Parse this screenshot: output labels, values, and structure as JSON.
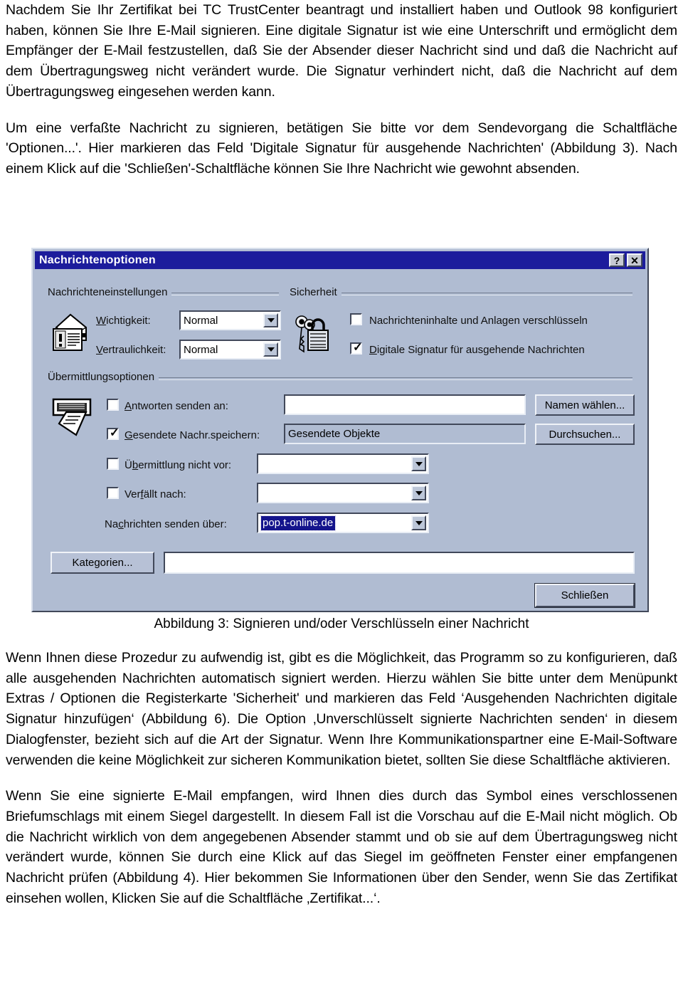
{
  "document": {
    "paragraphs": [
      "Nachdem Sie Ihr Zertifikat bei TC TrustCenter beantragt und installiert haben und Outlook 98 konfiguriert haben, können Sie Ihre E-Mail signieren. Eine digitale Signatur ist wie eine Unterschrift und ermöglicht dem Empfänger der E-Mail festzustellen, daß Sie der Absender dieser Nachricht sind und daß die Nachricht auf dem Übertragungsweg nicht verändert wurde. Die Signatur verhindert nicht, daß die Nachricht auf dem Übertragungsweg eingesehen werden kann.",
      "Um eine verfaßte Nachricht zu signieren, betätigen Sie bitte vor dem Sendevorgang die Schaltfläche 'Optionen...'. Hier markieren das Feld 'Digitale Signatur für ausgehende Nachrichten' (Abbildung 3). Nach einem Klick auf die 'Schließen'-Schaltfläche können Sie Ihre Nachricht wie gewohnt absenden.",
      "Wenn Ihnen diese Prozedur zu aufwendig ist, gibt es die Möglichkeit, das Programm so zu konfigurieren, daß alle ausgehenden Nachrichten automatisch signiert werden. Hierzu wählen Sie bitte unter dem Menüpunkt Extras / Optionen  die Registerkarte 'Sicherheit' und markieren das Feld ‘Ausgehenden Nachrichten digitale Signatur hinzufügen‘ (Abbildung 6). Die Option ‚Unverschlüsselt signierte Nachrichten senden‘ in diesem Dialogfenster, bezieht sich auf die Art der Signatur. Wenn Ihre Kommunikationspartner eine E-Mail-Software verwenden die keine Möglichkeit zur sicheren Kommunikation bietet, sollten Sie diese Schaltfläche aktivieren.",
      "Wenn Sie eine signierte E-Mail empfangen, wird Ihnen dies durch das Symbol eines verschlossenen Briefumschlags mit einem Siegel dargestellt. In diesem Fall ist die Vorschau auf die E-Mail nicht möglich. Ob die Nachricht wirklich von dem angegebenen Absender stammt und ob sie auf dem Übertragungsweg nicht verändert wurde, können Sie durch eine Klick auf das Siegel im geöffneten Fenster einer empfangenen Nachricht prüfen (Abbildung 4). Hier bekommen Sie Informationen über den Sender, wenn Sie das Zertifikat einsehen wollen, Klicken Sie auf die Schaltfläche ‚Zertifikat...‘."
    ],
    "figure_caption": "Abbildung 3: Signieren und/oder Verschlüsseln einer Nachricht"
  },
  "dialog": {
    "title": "Nachrichtenoptionen",
    "help_button": "?",
    "close_button": "✕",
    "groups": {
      "message_settings": {
        "label": "Nachrichteneinstellungen",
        "importance_label": "Wichtigkeit:",
        "importance_value": "Normal",
        "sensitivity_label": "Vertraulichkeit:",
        "sensitivity_value": "Normal"
      },
      "security": {
        "label": "Sicherheit",
        "encrypt_label": "Nachrichteninhalte und Anlagen verschlüsseln",
        "encrypt_checked": false,
        "sign_label": "Digitale Signatur für ausgehende Nachrichten",
        "sign_checked": true
      },
      "delivery": {
        "label": "Übermittlungsoptionen",
        "reply_to_label": "Antworten senden an:",
        "reply_to_checked": false,
        "reply_to_value": "",
        "save_sent_label": "Gesendete Nachr.speichern:",
        "save_sent_checked": true,
        "save_sent_value": "Gesendete Objekte",
        "do_not_deliver_label": "Übermittlung nicht vor:",
        "do_not_deliver_checked": false,
        "do_not_deliver_value": "",
        "expires_label": "Verfällt nach:",
        "expires_checked": false,
        "expires_value": "",
        "send_using_label": "Nachrichten senden über:",
        "send_using_value": "pop.t-online.de",
        "choose_names_button": "Namen wählen...",
        "browse_button": "Durchsuchen..."
      }
    },
    "categories_button": "Kategorien...",
    "categories_value": "",
    "close_action_button": "Schließen",
    "icons": {
      "message_settings": "envelope-exclamation-icon",
      "security": "padlock-keys-icon",
      "delivery": "mail-slot-envelope-icon"
    },
    "colors": {
      "titlebar": "#1c1c9c",
      "face": "#b0bcd2",
      "selection": "#14148c",
      "field": "#ffffff"
    }
  }
}
